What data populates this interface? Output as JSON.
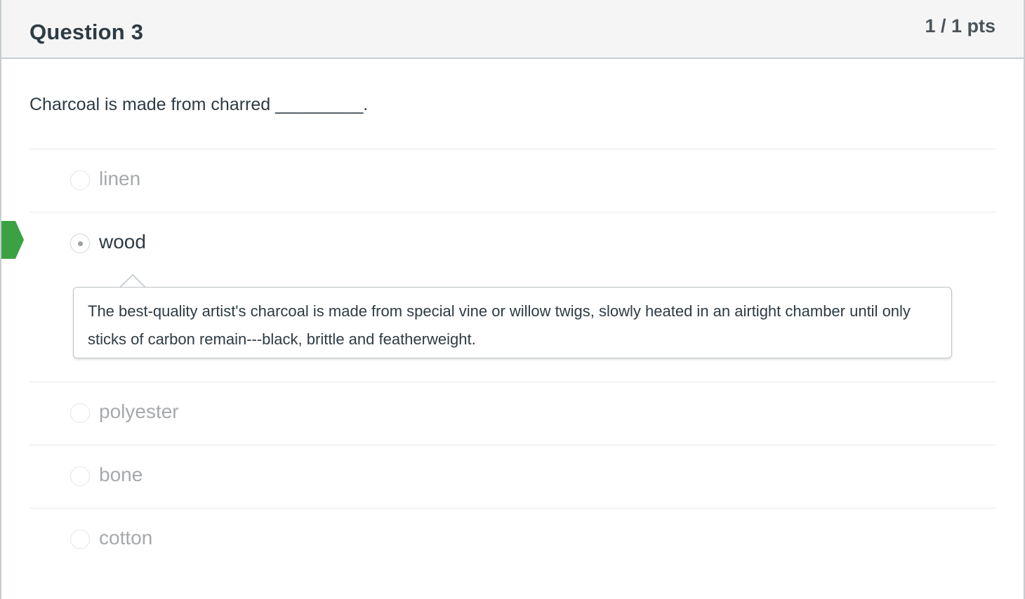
{
  "question": {
    "title": "Question 3",
    "points": "1 / 1 pts",
    "text": "Charcoal is made from charred _________."
  },
  "answers": [
    {
      "label": "linen",
      "selected": false
    },
    {
      "label": "wood",
      "selected": true,
      "correct": true,
      "comment": "The best-quality artist's charcoal is made from special vine or willow twigs, slowly heated in an airtight chamber until only sticks of carbon remain---black, brittle and featherweight."
    },
    {
      "label": "polyester",
      "selected": false
    },
    {
      "label": "bone",
      "selected": false
    },
    {
      "label": "cotton",
      "selected": false
    }
  ],
  "colors": {
    "correct_marker": "#3ba143",
    "header_bg": "#f5f5f5",
    "border": "#c7cdd1"
  },
  "icons": {
    "correct_marker": "correct-answer-flag-icon",
    "radio": "radio-icon"
  }
}
